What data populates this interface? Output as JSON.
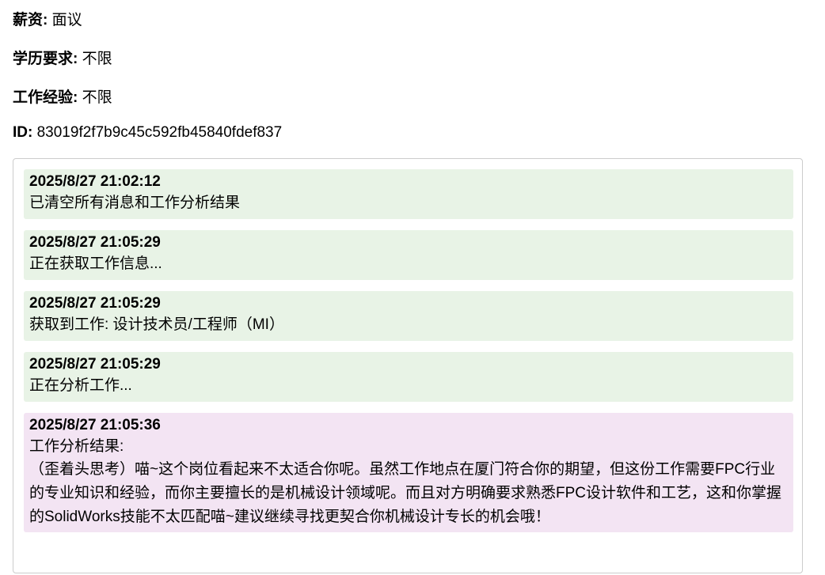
{
  "job_info": {
    "salary": {
      "label": "薪资:",
      "value": "面议"
    },
    "education": {
      "label": "学历要求:",
      "value": "不限"
    },
    "experience": {
      "label": "工作经验:",
      "value": "不限"
    },
    "id": {
      "label": "ID:",
      "value": "83019f2f7b9c45c592fb45840fdef837"
    }
  },
  "log": {
    "entries": [
      {
        "time": "2025/8/27 21:02:12",
        "message": "已清空所有消息和工作分析结果",
        "kind": "info"
      },
      {
        "time": "2025/8/27 21:05:29",
        "message": "正在获取工作信息...",
        "kind": "info"
      },
      {
        "time": "2025/8/27 21:05:29",
        "message": "获取到工作: 设计技术员/工程师（MI）",
        "kind": "info"
      },
      {
        "time": "2025/8/27 21:05:29",
        "message": "正在分析工作...",
        "kind": "info"
      },
      {
        "time": "2025/8/27 21:05:36",
        "message": "工作分析结果:",
        "detail": "（歪着头思考）喵~这个岗位看起来不太适合你呢。虽然工作地点在厦门符合你的期望，但这份工作需要FPC行业的专业知识和经验，而你主要擅长的是机械设计领域呢。而且对方明确要求熟悉FPC设计软件和工艺，这和你掌握的SolidWorks技能不太匹配喵~建议继续寻找更契合你机械设计专长的机会哦！",
        "kind": "result"
      }
    ]
  }
}
